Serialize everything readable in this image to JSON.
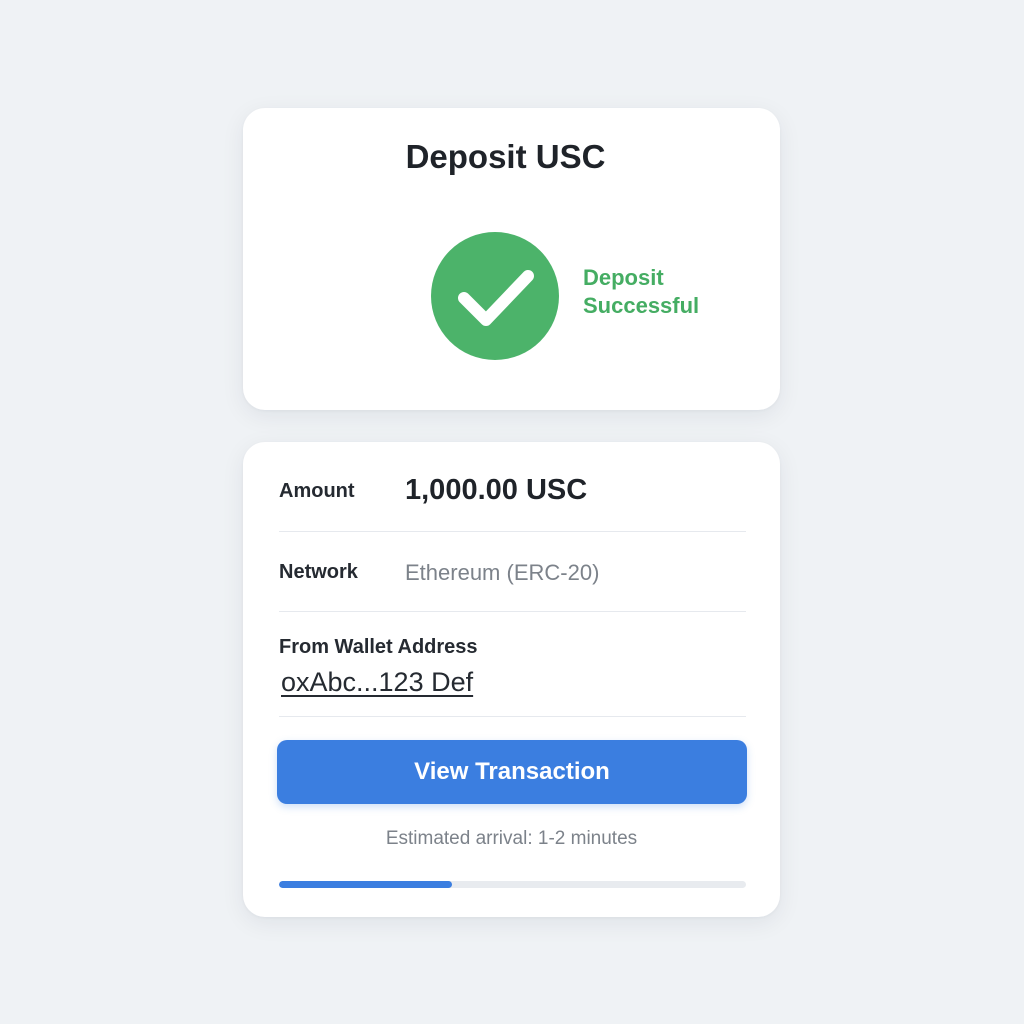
{
  "header": {
    "title": "Deposit USC"
  },
  "status": {
    "icon": "check-circle-icon",
    "line1": "Deposit",
    "line2": "Successful",
    "color": "#45ad63"
  },
  "details": {
    "amount": {
      "label": "Amount",
      "value": "1,000.00 USC"
    },
    "network": {
      "label": "Network",
      "value": "Ethereum (ERC-20)"
    },
    "wallet": {
      "label": "From Wallet Address",
      "value": "oxAbc...123 Def"
    }
  },
  "actions": {
    "view_transaction_label": "View Transaction",
    "accent_color": "#3b7ee0"
  },
  "eta": {
    "text": "Estimated arrival: 1-2 minutes"
  },
  "progress": {
    "fraction": 0.37
  }
}
